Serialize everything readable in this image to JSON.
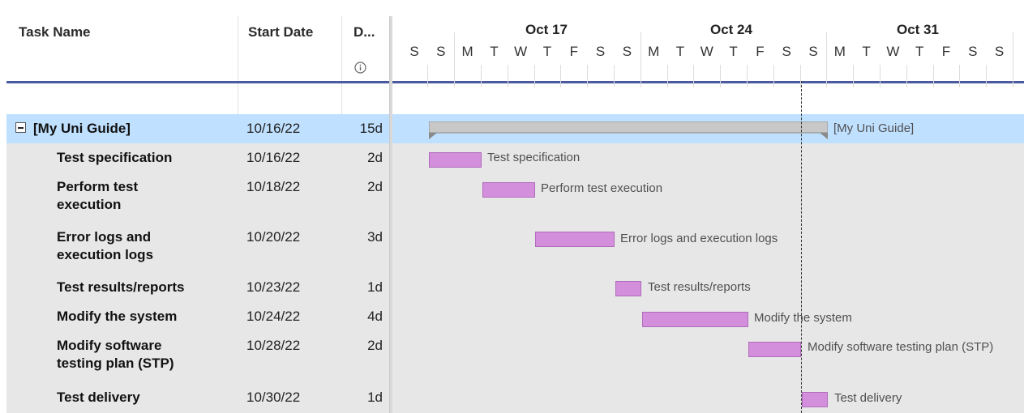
{
  "columns": {
    "task_name": "Task Name",
    "start_date": "Start Date",
    "duration": "D...",
    "duration_info_icon": "info-icon"
  },
  "parent": {
    "name": "[My Uni Guide]",
    "start": "10/16/22",
    "duration": "15d",
    "bar_label": "[My Uni Guide]"
  },
  "tasks": [
    {
      "name": "Test specification",
      "start": "10/16/22",
      "duration": "2d",
      "bar_label": "Test specification"
    },
    {
      "name": "Perform test execution",
      "start": "10/18/22",
      "duration": "2d",
      "bar_label": "Perform test execution"
    },
    {
      "name": "Error logs and execution logs",
      "start": "10/20/22",
      "duration": "3d",
      "bar_label": "Error logs and execution logs"
    },
    {
      "name": "Test results/reports",
      "start": "10/23/22",
      "duration": "1d",
      "bar_label": "Test results/reports"
    },
    {
      "name": "Modify the system",
      "start": "10/24/22",
      "duration": "4d",
      "bar_label": "Modify the system"
    },
    {
      "name": "Modify software testing plan (STP)",
      "start": "10/28/22",
      "duration": "2d",
      "bar_label": "Modify software testing plan (STP)"
    },
    {
      "name": "Test delivery",
      "start": "10/30/22",
      "duration": "1d",
      "bar_label": "Test delivery"
    }
  ],
  "timeline": {
    "weeks": [
      "Oct 17",
      "Oct 24",
      "Oct 31"
    ],
    "days": [
      "S",
      "S",
      "M",
      "T",
      "W",
      "T",
      "F",
      "S",
      "S",
      "M",
      "T",
      "W",
      "T",
      "F",
      "S",
      "S",
      "M",
      "T",
      "W",
      "T",
      "F",
      "S",
      "S"
    ]
  },
  "colors": {
    "task_bar": "#d48fdc",
    "summary_bar": "#c8c8c8",
    "selected_row": "#bfe0ff",
    "header_line": "#4a5aa0"
  }
}
